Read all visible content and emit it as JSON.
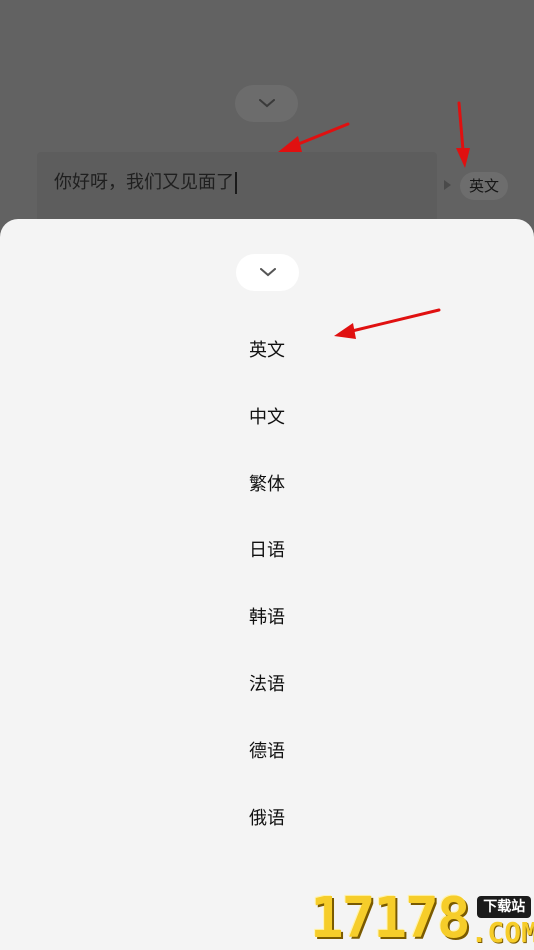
{
  "background": {
    "input_text": "你好呀，我们又见面了",
    "target_language": "英文"
  },
  "sheet": {
    "languages": [
      "英文",
      "中文",
      "繁体",
      "日语",
      "韩语",
      "法语",
      "德语",
      "俄语"
    ]
  },
  "watermark": {
    "number": "17178",
    "badge": "下载站",
    "domain": ".COM"
  },
  "colors": {
    "overlay": "#626262",
    "sheet": "#f4f4f4",
    "arrow": "#e01010",
    "watermark": "#f6cd2a"
  }
}
